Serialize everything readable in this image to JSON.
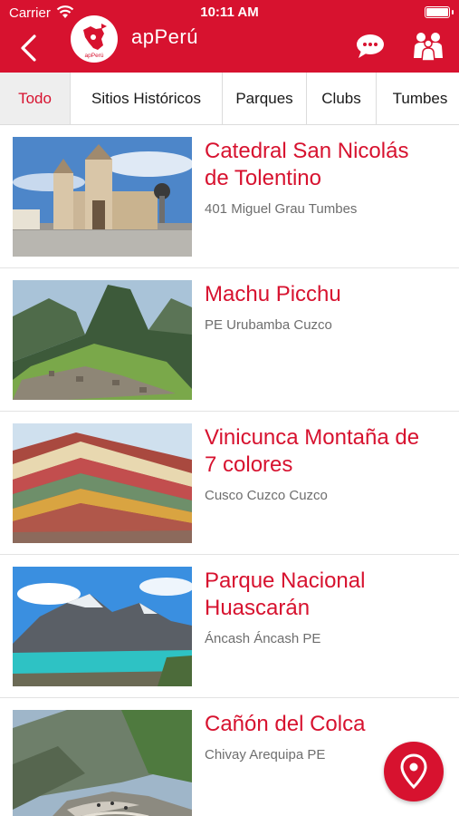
{
  "status_bar": {
    "carrier": "Carrier",
    "time": "10:11 AM"
  },
  "header": {
    "title": "apPerú",
    "logo_text": "apPerú"
  },
  "tabs": [
    {
      "label": "Todo",
      "active": true
    },
    {
      "label": "Sitios Históricos"
    },
    {
      "label": "Parques"
    },
    {
      "label": "Clubs"
    },
    {
      "label": "Tumbes"
    }
  ],
  "places": [
    {
      "name_line1": "Catedral San Nicolás",
      "name_line2": "de Tolentino",
      "address": "401 Miguel Grau Tumbes",
      "image": "cathedral-photo"
    },
    {
      "name_line1": "Machu Picchu",
      "name_line2": "",
      "address": "PE Urubamba Cuzco",
      "image": "machu-picchu-photo"
    },
    {
      "name_line1": "Vinicunca Montaña de",
      "name_line2": "7 colores",
      "address": "Cusco Cuzco Cuzco",
      "image": "rainbow-mountain-photo"
    },
    {
      "name_line1": "Parque Nacional",
      "name_line2": "Huascarán",
      "address": "Áncash Áncash PE",
      "image": "huascaran-lake-photo"
    },
    {
      "name_line1": "Cañón del Colca",
      "name_line2": "",
      "address": "Chivay Arequipa PE",
      "image": "colca-canyon-photo"
    }
  ],
  "colors": {
    "brand_red": "#d7122f",
    "text_gray": "#6e6e6e"
  },
  "icons": [
    "wifi-icon",
    "battery-icon",
    "back-chevron-icon",
    "chat-bubble-icon",
    "users-group-icon",
    "map-pin-icon"
  ]
}
